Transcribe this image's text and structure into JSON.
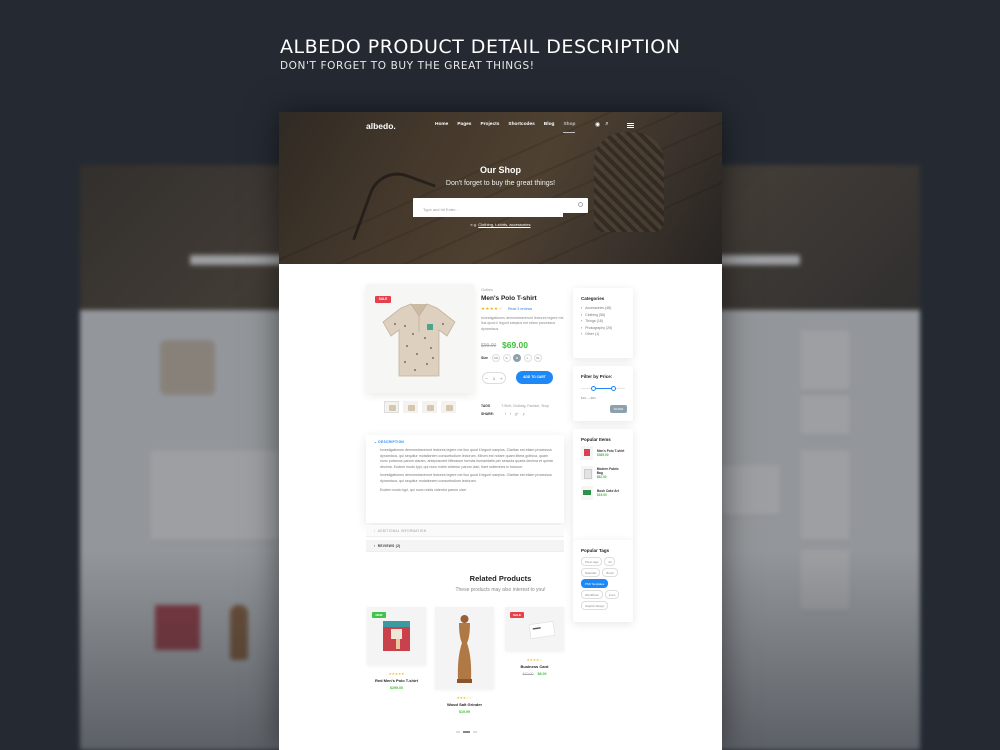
{
  "headline": {
    "title": "ALBEDO PRODUCT DETAIL DESCRIPTION",
    "subtitle": "DON'T FORGET TO BUY THE GREAT THINGS!"
  },
  "nav": {
    "logo": "albedo.",
    "items": [
      "Home",
      "Pages",
      "Projects",
      "Shortcodes",
      "Blog",
      "Shop"
    ],
    "active": "Shop",
    "icons": [
      "cart-icon",
      "search-icon",
      "menu-icon"
    ]
  },
  "hero": {
    "title": "Our Shop",
    "subtitle": "Don't forget to buy the great things!",
    "search_placeholder": "Type and hit Enter...",
    "eg_prefix": "e.g.",
    "eg_links": "Clothing, t-shirts, accessories"
  },
  "product": {
    "badge": "SALE",
    "category": "Clothes",
    "name": "Men's Polo T-shirt",
    "stars": "★★★★☆",
    "reviews": "Read 3 reviews",
    "description": "Investigationes demonstraverunt lectores legere me lius quod ii legunt saepius est etiam processus dynamicus.",
    "old_price": "$99.00",
    "price": "$69.00",
    "size_label": "Size",
    "sizes": [
      "XS",
      "S",
      "M",
      "L",
      "XL"
    ],
    "selected_size": "M",
    "qty": "1",
    "qty_minus": "−",
    "qty_plus": "+",
    "add_to_cart": "ADD TO CART",
    "tags_label": "TAGS",
    "tags": "T-Shirt, Clothing, Fashion, Shop",
    "share_label": "SHARE:",
    "share_icons": [
      "facebook-icon",
      "twitter-icon",
      "google-plus-icon",
      "pinterest-icon"
    ]
  },
  "tabs": {
    "description_label": "DESCRIPTION",
    "p1": "Investigationes demonstraverunt lectores legere me lius quod ii legunt saepius. Claritas est etiam processus dynamicus, qui sequitur mutationem consuetudium lectorum. Mirum est notare quam littera gothica, quam nunc putamus parum claram, anteposuerit litterarum formas humanitatis per seacula quarta decima et quinta decima. Eodem modo typi, qui nunc nobis videntur parum clari, fiant sollemnes in futurum.",
    "p2": "Investigationes demonstraverunt lectores legere me lius quod ii legunt saepius. Claritas est etiam processus dynamicus, qui sequitur mutationem consuetudium lectorum.",
    "p3": "Eodem modo typi, qui nunc nobis videntur parum clari.",
    "additional": "ADDITIONAL INFORMATION",
    "reviews": "REVIEWS (2)"
  },
  "sidebar": {
    "categories_title": "Categories",
    "categories": [
      "Accessories (48)",
      "Clothing (56)",
      "Things (18)",
      "Photography (25)",
      "Other (1)"
    ],
    "filter_title": "Filter by Price:",
    "price_range": "$10 — $84",
    "filter_button": "FILTER",
    "popular_title": "Popular Items",
    "popular": [
      {
        "name": "Men's Polo T-shirt",
        "price": "$389.00"
      },
      {
        "name": "Modern Fabric Bag",
        "price": "$82.00"
      },
      {
        "name": "Book Cake Art",
        "price": "$15.00"
      }
    ],
    "tags_title": "Popular Tags",
    "tags": [
      "Photo tags",
      "All",
      "Materials",
      "Brush",
      "PSD Templates",
      "WordPress",
      "Icons",
      "Graphic Design"
    ],
    "active_tag": "PSD Templates"
  },
  "related": {
    "title": "Related Products",
    "subtitle": "These products may also interest to you!",
    "items": [
      {
        "badge": "NEW",
        "stars": "★★★★★",
        "name": "Red Men's Polo T-shirt",
        "old_price": "",
        "price": "$299.00"
      },
      {
        "badge": "",
        "stars": "★★★☆☆",
        "name": "Wood Salt Grinder",
        "old_price": "",
        "price": "$19.99"
      },
      {
        "badge": "SALE",
        "stars": "★★★★☆",
        "name": "Business Card",
        "old_price": "$10.00",
        "price": "$8.00"
      }
    ]
  },
  "colors": {
    "accent": "#1e88f7",
    "price_green": "#3fbf3a",
    "sale_red": "#e8404a",
    "new_green": "#3ec44a",
    "background": "#252a32"
  }
}
